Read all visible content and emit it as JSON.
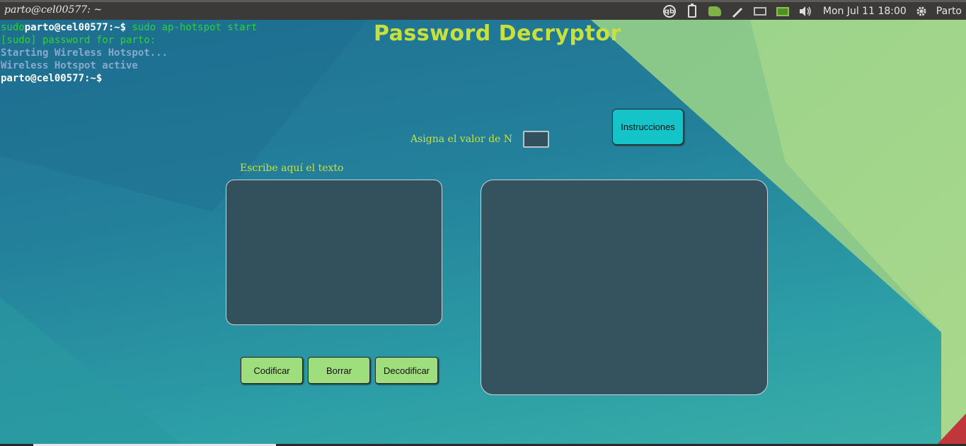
{
  "topbar": {
    "window_title": "parto@cel00577: ~",
    "tray_icons": [
      "qbittorrent-icon",
      "clipboard-icon",
      "green-app-icon",
      "pen-tool-icon",
      "mail-icon",
      "battery-icon",
      "volume-icon"
    ],
    "qb_label": "qb",
    "clock": "Mon Jul 11 18:00",
    "user": "Parto"
  },
  "terminal": {
    "line1_prefix": "sudo",
    "line1_prompt": "parto@cel00577:~$",
    "line1_cmd": " sudo ap-hotspot start",
    "line2": "[sudo] password for parto:",
    "line3": "Starting Wireless Hotspot...",
    "line4": "Wireless Hotspot active",
    "line5": "parto@cel00577:~$"
  },
  "app": {
    "title": "Password Decryptor",
    "n_label": "Asigna el valor de N",
    "n_value": "",
    "instructions_button": "Instrucciones",
    "text_label": "Escribe aquí el texto",
    "input_text": "",
    "output_text": "",
    "buttons": {
      "encode": "Codificar",
      "clear": "Borrar",
      "decode": "Decodificar"
    }
  },
  "colors": {
    "title_color": "#c8e03b",
    "instructions_bg": "#15c4c8",
    "action_button_bg": "#9fde7c",
    "textarea_bg": "#33505d"
  }
}
